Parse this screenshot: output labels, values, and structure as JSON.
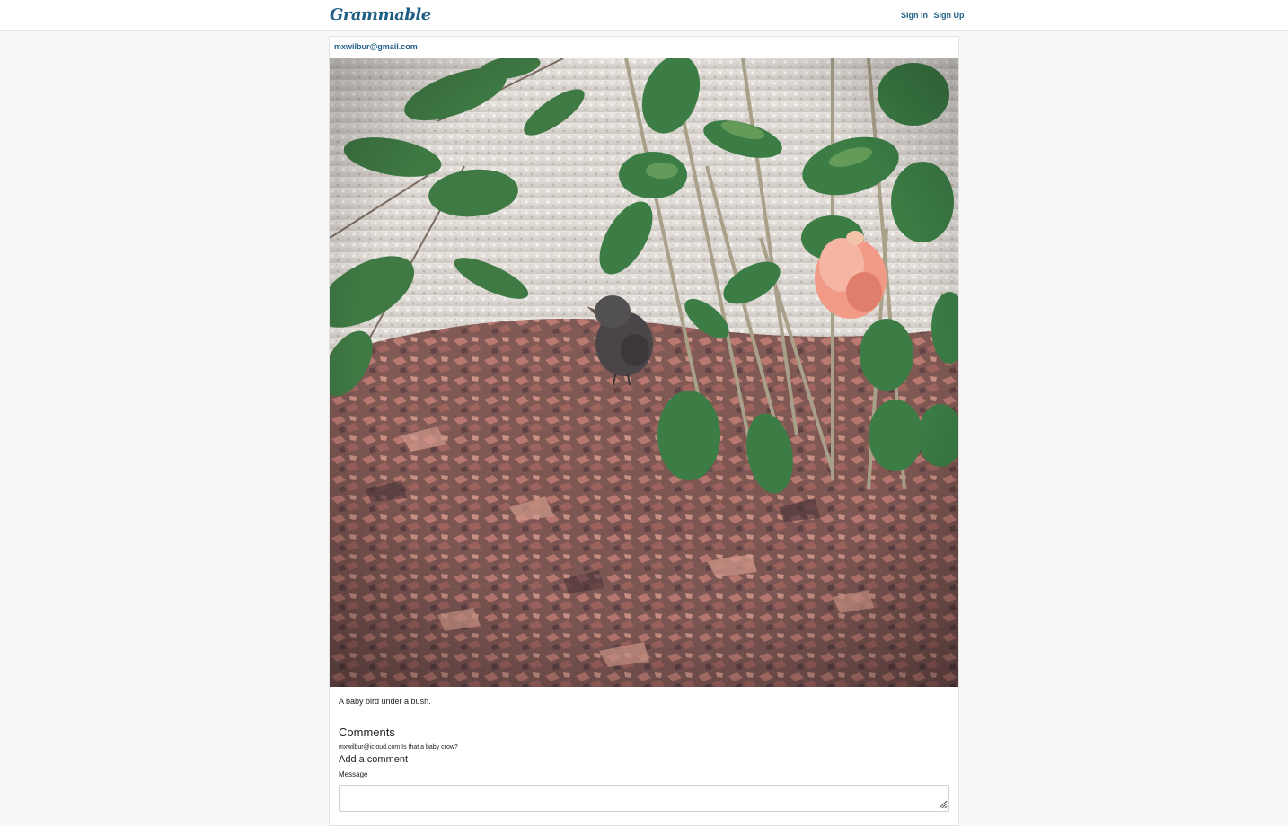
{
  "navbar": {
    "brand": "Grammable",
    "sign_in": "Sign In",
    "sign_up": "Sign Up"
  },
  "post": {
    "author": "mxwilbur@gmail.com",
    "caption": "A baby bird under a bush.",
    "comments_title": "Comments",
    "comments": [
      {
        "user": "mxwilbur@icloud.com",
        "text": "Is that a baby crow?"
      }
    ],
    "add_comment_title": "Add a comment",
    "message_label": "Message",
    "message_value": ""
  }
}
